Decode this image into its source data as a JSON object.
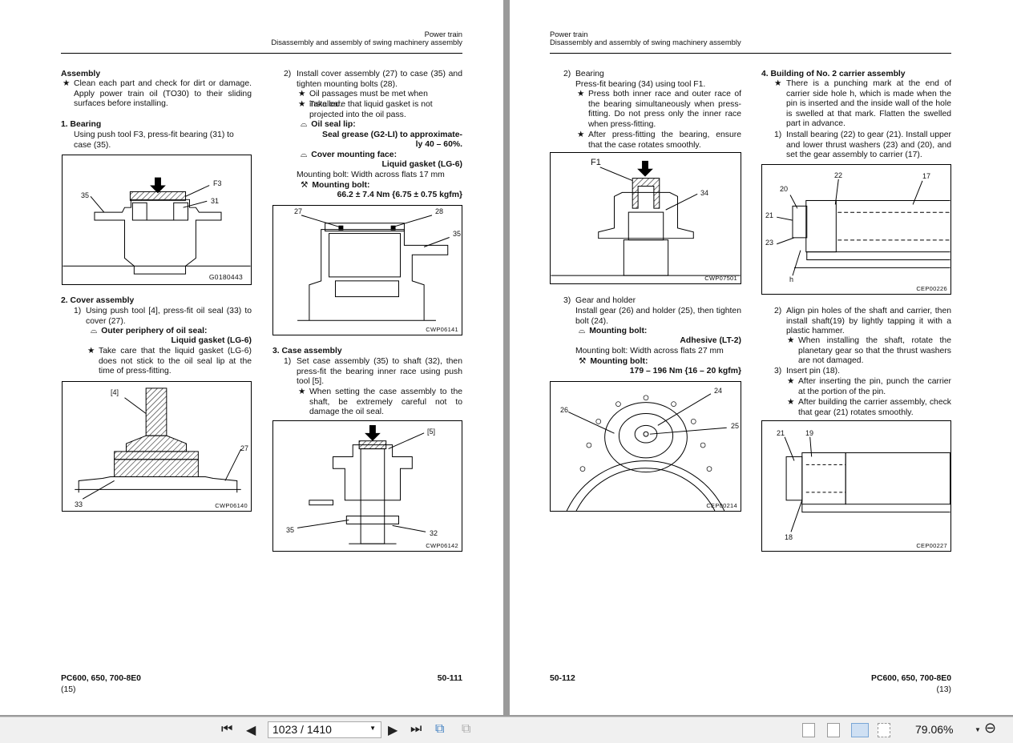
{
  "left_page": {
    "header": [
      "Power train",
      "Disassembly and assembly of swing machinery assembly"
    ],
    "assembly_title": "Assembly",
    "assembly_note": "Clean each part and check for dirt or damage. Apply power train oil (TO30) to their sliding surfaces before installing.",
    "s1_title": "1.  Bearing",
    "s1_text": "Using push tool F3, press-fit bearing (31) to case (35).",
    "s2_title": "2.  Cover assembly",
    "s2_step1_num": "1)",
    "s2_step1": "Using push tool [4], press-fit oil seal (33) to cover (27).",
    "s2_step1_spec_label": "Outer periphery of oil seal:",
    "s2_step1_spec_value": "Liquid gasket (LG-6)",
    "s2_step1_note": "Take care that the liquid gasket (LG-6) does not stick to the oil seal lip at the time of press-fitting.",
    "s2_step2_num": "2)",
    "s2_step2": "Install cover assembly (27) to case (35) and tighten mounting bolts (28).",
    "s2_step2_note1": "Oil passages must be met when installed.",
    "s2_step2_note2": "Take care that liquid gasket is not projected into the oil pass.",
    "spec1_label": "Oil seal lip:",
    "spec1_value1": "Seal grease (G2-LI) to approximate-",
    "spec1_value2": "ly 40 – 60%.",
    "spec2_label": "Cover mounting face:",
    "spec2_value": "Liquid gasket (LG-6)",
    "bolt_size": "Mounting bolt: Width across flats 17 mm",
    "torque_label": "Mounting bolt:",
    "torque_value": "66.2 ± 7.4 Nm {6.75 ± 0.75 kgfm}",
    "s3_title": "3.  Case assembly",
    "s3_step1_num": "1)",
    "s3_step1": "Set case assembly (35) to shaft (32), then press-fit the bearing inner race using push tool [5].",
    "s3_step1_note": "When setting the case assembly to the shaft, be extremely careful not to damage the oil seal.",
    "fig1": {
      "code": "G0180443",
      "labels": [
        "F3",
        "35",
        "31"
      ]
    },
    "fig2": {
      "code": "CWP06140",
      "labels": [
        "[4]",
        "27",
        "33"
      ]
    },
    "fig3": {
      "code": "CWP06141",
      "labels": [
        "27",
        "28",
        "35"
      ]
    },
    "fig4": {
      "code": "CWP06142",
      "labels": [
        "[5]",
        "35",
        "32"
      ]
    },
    "footer_model": "PC600, 650, 700-8E0",
    "footer_rev": "(15)",
    "page_number": "50-111"
  },
  "right_page": {
    "header": [
      "Power train",
      "Disassembly and assembly of swing machinery assembly"
    ],
    "b_num": "2)",
    "b_title": "Bearing",
    "b_text": "Press-fit bearing (34) using tool F1.",
    "b_note1": "Press both inner race and outer race of the bearing simultaneously when press-fitting. Do not press only the inner race when press-fitting.",
    "b_note2": "After press-fitting the bearing, ensure that the case rotates smoothly.",
    "g_num": "3)",
    "g_title": "Gear and holder",
    "g_text": "Install gear (26) and holder (25), then tighten bolt (24).",
    "g_spec_label": "Mounting bolt:",
    "g_spec_value": "Adhesive (LT-2)",
    "g_bolt_size": "Mounting bolt: Width across flats 27 mm",
    "g_torque_label": "Mounting bolt:",
    "g_torque_value": "179 – 196 Nm {16 – 20 kgfm}",
    "s4_title": "4.  Building of No. 2 carrier assembly",
    "s4_note": "There is a punching mark at the end of carrier side hole h, which is made when the pin is inserted and the inside wall of the hole is swelled at that mark. Flatten the swelled part in advance.",
    "s4_step1_num": "1)",
    "s4_step1": "Install bearing (22) to gear (21). Install upper and lower thrust washers (23) and (20), and set the gear assembly to carrier (17).",
    "s4_step2_num": "2)",
    "s4_step2": "Align pin holes of the shaft and carrier, then install shaft(19) by lightly tapping it with a plastic hammer.",
    "s4_step2_note": "When installing the shaft, rotate the planetary gear so that the thrust washers are not damaged.",
    "s4_step3_num": "3)",
    "s4_step3": "Insert pin (18).",
    "s4_step3_note1": "After inserting the pin, punch the carrier at the portion of the pin.",
    "s4_step3_note2": "After building the carrier assembly, check that gear (21) rotates smoothly.",
    "fig5": {
      "code": "CWP07501",
      "labels": [
        "F1",
        "34"
      ]
    },
    "fig6": {
      "code": "CEP00214",
      "labels": [
        "26",
        "24",
        "25"
      ]
    },
    "fig7": {
      "code": "CEP00226",
      "labels": [
        "22",
        "17",
        "20",
        "21",
        "23",
        "h"
      ]
    },
    "fig8": {
      "code": "CEP00227",
      "labels": [
        "21",
        "19",
        "18"
      ]
    },
    "footer_model": "PC600, 650, 700-8E0",
    "footer_rev": "(13)",
    "page_number": "50-112"
  },
  "star": "★",
  "toolbar": {
    "page_input": "1023 / 1410",
    "zoom": "79.06%"
  }
}
